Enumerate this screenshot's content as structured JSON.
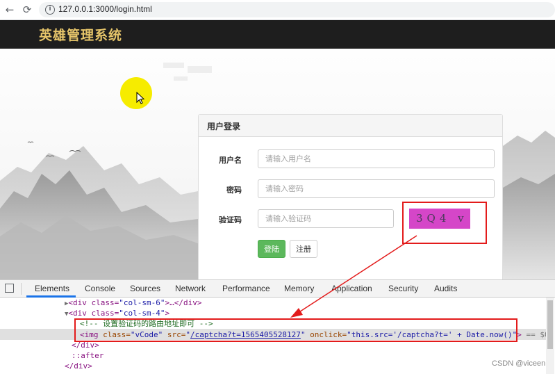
{
  "browser": {
    "back_icon": "←",
    "reload_icon": "⟳",
    "info_icon": "i",
    "url": "127.0.0.1:3000/login.html"
  },
  "app": {
    "title": "英雄管理系统"
  },
  "login": {
    "heading": "用户登录",
    "username_label": "用户名",
    "username_placeholder": "请输入用户名",
    "password_label": "密码",
    "password_placeholder": "请输入密码",
    "captcha_label": "验证码",
    "captcha_placeholder": "请输入验证码",
    "captcha_text": "3Q4 v",
    "login_button": "登陆",
    "register_button": "注册"
  },
  "devtools": {
    "tabs": [
      "Elements",
      "Console",
      "Sources",
      "Network",
      "Performance",
      "Memory",
      "Application",
      "Security",
      "Audits"
    ],
    "active_tab": "Elements",
    "lines": {
      "l1_open": "<div class=",
      "l1_val": "\"col-sm-6\"",
      "l1_rest": ">…</div>",
      "l2_open": "<div class=",
      "l2_val": "\"col-sm-4\"",
      "l2_rest": ">",
      "l3_comment": "<!-- 设置验证码的路由地址即可 -->",
      "l4_tag": "<img ",
      "l4_attr1": "class=",
      "l4_val1": "\"vCode\"",
      "l4_attr2": " src=",
      "l4_q1": "\"",
      "l4_link": "/captcha?t=1565405528127",
      "l4_q2": "\"",
      "l4_attr3": " onclick=",
      "l4_val3": "\"this.src='/captcha?t=' + Date.now()\"",
      "l4_end": ">",
      "l4_eq": " == $0",
      "l5": "</div>",
      "l6": "::after",
      "l7": "</div>"
    }
  },
  "watermark": "CSDN @viceen",
  "colors": {
    "header_bg": "#1e1e1e",
    "title_gold": "#e6c56a",
    "login_green": "#5cb85c",
    "annotation_red": "#e31b1b",
    "captcha_bg": "#d546c8",
    "highlight_yellow": "#f6ec00"
  }
}
